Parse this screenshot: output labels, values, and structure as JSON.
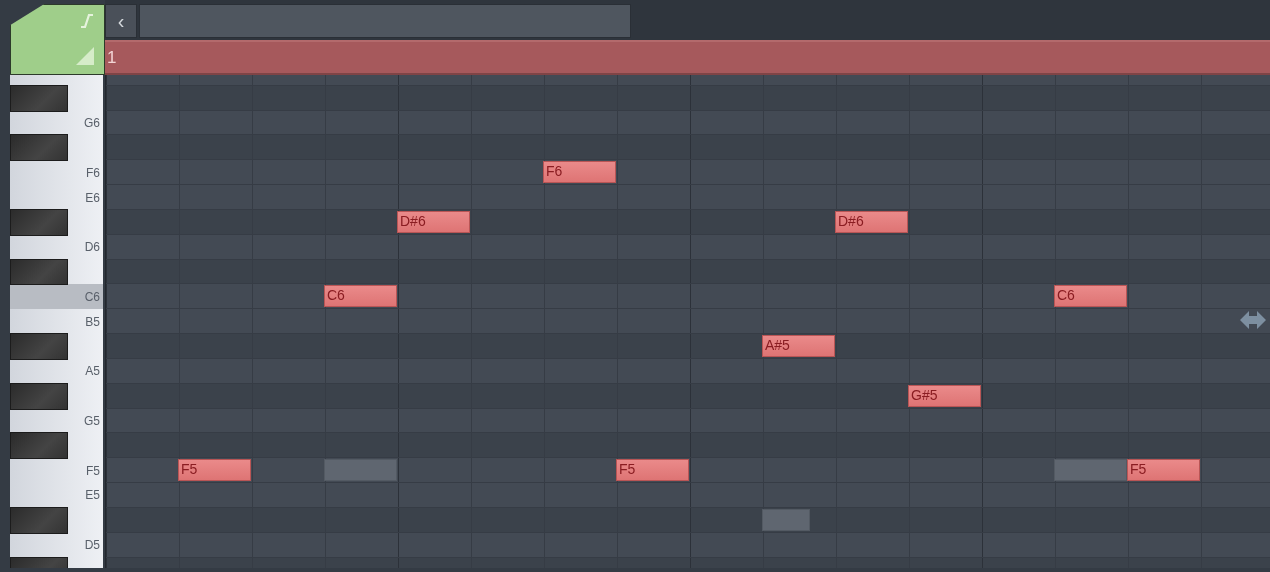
{
  "toolbar": {
    "back_label": "‹",
    "bar_label": "1"
  },
  "keyboard": {
    "keys": [
      {
        "kind": "white",
        "highlighted": false
      },
      {
        "kind": "black",
        "highlighted": false
      },
      {
        "kind": "white",
        "label": "G6",
        "highlighted": false
      },
      {
        "kind": "black",
        "highlighted": false
      },
      {
        "kind": "white",
        "label": "F6",
        "highlighted": false
      },
      {
        "kind": "white",
        "label": "E6",
        "highlighted": false
      },
      {
        "kind": "black",
        "highlighted": false
      },
      {
        "kind": "white",
        "label": "D6",
        "highlighted": false
      },
      {
        "kind": "black",
        "highlighted": false
      },
      {
        "kind": "white",
        "label": "C6",
        "highlighted": true
      },
      {
        "kind": "white",
        "label": "B5",
        "highlighted": false
      },
      {
        "kind": "black",
        "highlighted": false
      },
      {
        "kind": "white",
        "label": "A5",
        "highlighted": false
      },
      {
        "kind": "black",
        "highlighted": false
      },
      {
        "kind": "white",
        "label": "G5",
        "highlighted": false
      },
      {
        "kind": "black",
        "highlighted": false
      },
      {
        "kind": "white",
        "label": "F5",
        "highlighted": false
      },
      {
        "kind": "white",
        "label": "E5",
        "highlighted": false
      },
      {
        "kind": "black",
        "highlighted": false
      },
      {
        "kind": "white",
        "label": "D5",
        "highlighted": false
      },
      {
        "kind": "black",
        "highlighted": false
      }
    ]
  },
  "notes": [
    {
      "kind": "note",
      "label": "F5"
    },
    {
      "kind": "ghost"
    },
    {
      "kind": "note",
      "label": "C6"
    },
    {
      "kind": "note",
      "label": "D#6"
    },
    {
      "kind": "note",
      "label": "F6"
    },
    {
      "kind": "note",
      "label": "F5"
    },
    {
      "kind": "note",
      "label": "A#5"
    },
    {
      "kind": "ghost"
    },
    {
      "kind": "note",
      "label": "D#6"
    },
    {
      "kind": "note",
      "label": "G#5"
    },
    {
      "kind": "note",
      "label": "C6"
    },
    {
      "kind": "ghost"
    },
    {
      "kind": "note",
      "label": "F5"
    }
  ]
}
